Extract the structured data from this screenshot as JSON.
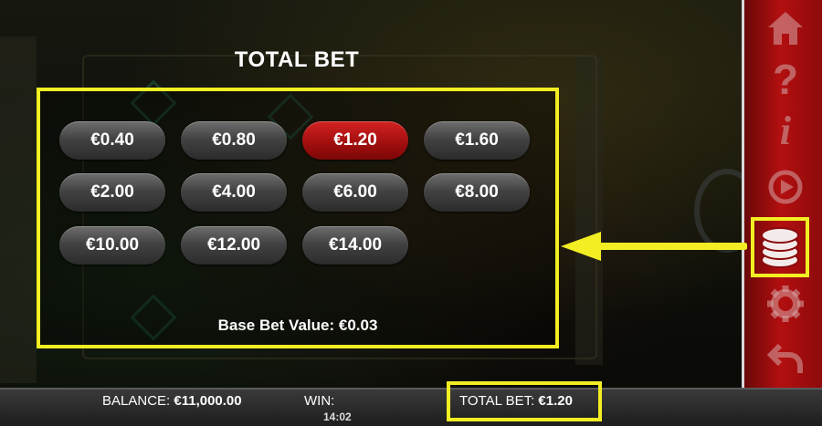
{
  "modal": {
    "title": "TOTAL BET",
    "selected": "€1.20",
    "base_bet_label": "Base Bet Value: €0.03",
    "bets": [
      "€0.40",
      "€0.80",
      "€1.20",
      "€1.60",
      "€2.00",
      "€4.00",
      "€6.00",
      "€8.00",
      "€10.00",
      "€12.00",
      "€14.00"
    ]
  },
  "sidebar": {
    "icons": [
      "home-icon",
      "help-icon",
      "info-icon",
      "autoplay-icon",
      "coins-icon",
      "settings-icon",
      "back-icon"
    ]
  },
  "bottom_bar": {
    "balance_label": "BALANCE:",
    "balance_value": "€11,000.00",
    "win_label": "WIN:",
    "clock": "14:02",
    "total_bet_label": "TOTAL BET:",
    "total_bet_value": "€1.20"
  },
  "colors": {
    "highlight": "#f2ee23",
    "selected_bet": "#c41515",
    "sidebar": "#b30f10"
  }
}
